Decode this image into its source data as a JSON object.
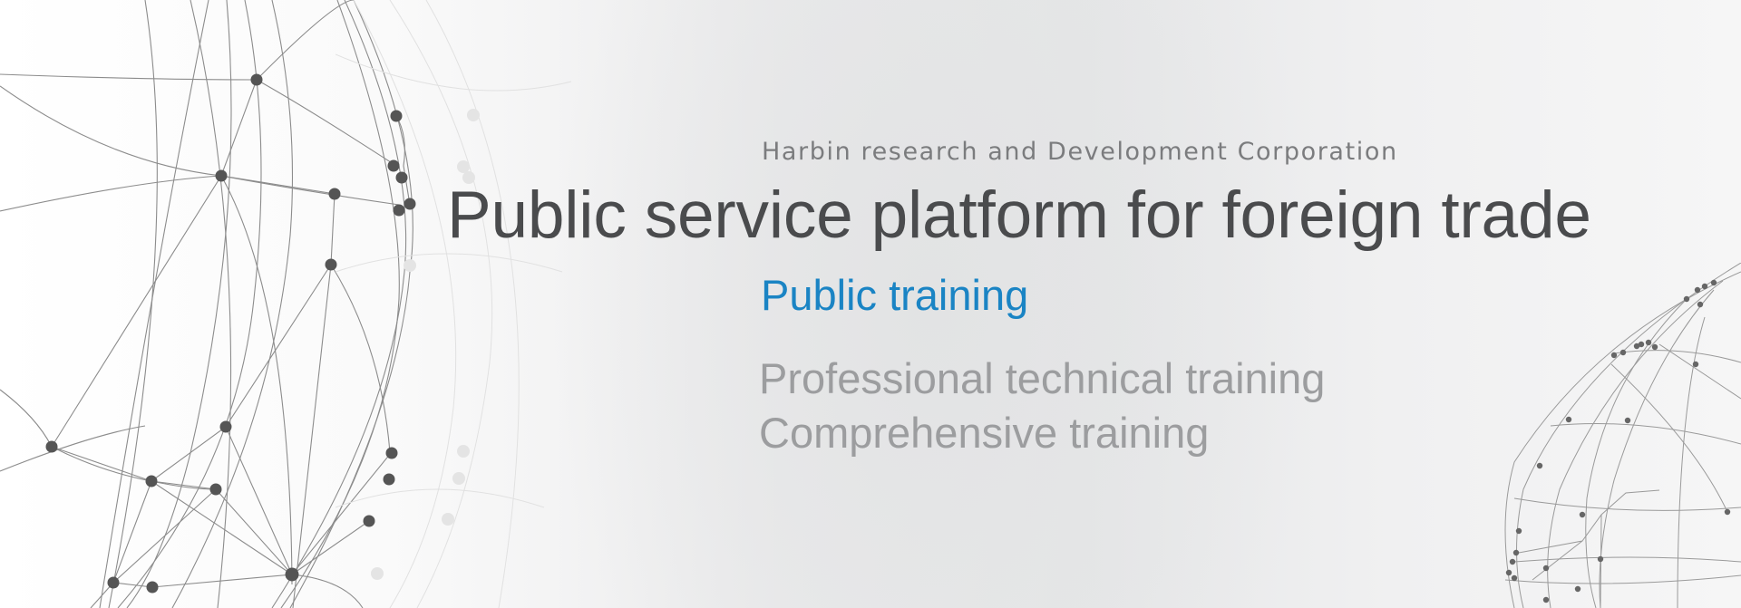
{
  "banner": {
    "company_name": "Harbin research and Development Corporation",
    "title": "Public service platform for foreign trade",
    "active_item": "Public training",
    "menu_items": [
      {
        "label": "Professional technical training"
      },
      {
        "label": "Comprehensive training"
      }
    ]
  },
  "colors": {
    "title": "#4a4b4d",
    "company": "#7b7c7e",
    "active": "#1a84c4",
    "inactive": "#9c9d9f",
    "network_lines": "#8c8c8c",
    "network_nodes": "#555555"
  },
  "icons": {
    "left_decoration": "network-globe-icon",
    "right_decoration": "network-globe-icon"
  }
}
